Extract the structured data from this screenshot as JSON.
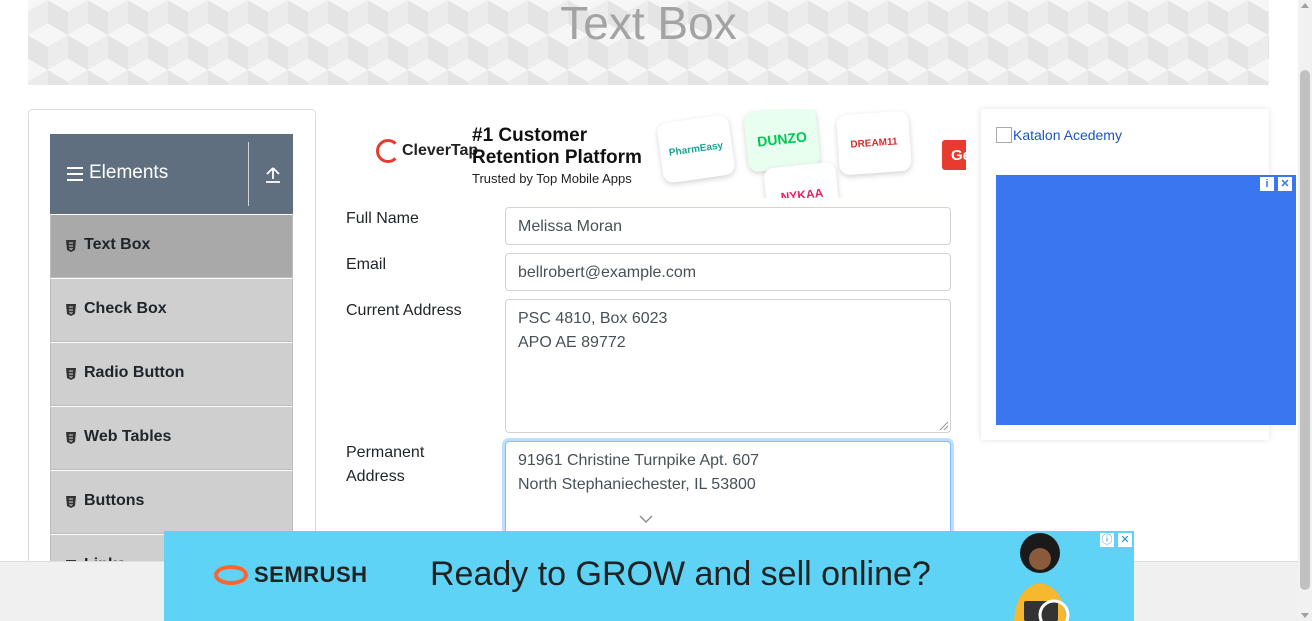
{
  "header": {
    "title": "Text Box"
  },
  "sidebar": {
    "group_title": "Elements",
    "items": [
      {
        "label": "Text Box",
        "active": true
      },
      {
        "label": "Check Box"
      },
      {
        "label": "Radio Button"
      },
      {
        "label": "Web Tables"
      },
      {
        "label": "Buttons"
      },
      {
        "label": "Links"
      }
    ]
  },
  "ad_top": {
    "brand": "CleverTap",
    "headline_1": "#1 Customer",
    "headline_2": "Retention Platform",
    "subline": "Trusted by Top Mobile Apps",
    "tiles": [
      "PharmEasy",
      "DUNZO",
      "DREAM11",
      "NYKAA"
    ],
    "cta": "Get"
  },
  "form": {
    "full_name": {
      "label": "Full Name",
      "value": "Melissa Moran"
    },
    "email": {
      "label": "Email",
      "value": "bellrobert@example.com"
    },
    "current_address": {
      "label": "Current Address",
      "line1": "PSC 4810, Box 6023",
      "line2": "APO AE 89772"
    },
    "permanent_address": {
      "label_line1": "Permanent",
      "label_line2": "Address",
      "line1": "91961 Christine Turnpike Apt. 607",
      "line2": "North Stephaniechester, IL 53800"
    }
  },
  "right_ad": {
    "alt_text": "Katalon Acedemy",
    "accent": "#3a76f0"
  },
  "bottom_ad": {
    "brand": "SEMRUSH",
    "tagline": "Ready to GROW and sell online?"
  },
  "colors": {
    "sidebar_header": "#5f6f7f",
    "menu_item": "#cfcfcf",
    "menu_active": "#a9a9a9",
    "ad_bottom": "#5fd3f5",
    "focus": "#80bdff"
  }
}
